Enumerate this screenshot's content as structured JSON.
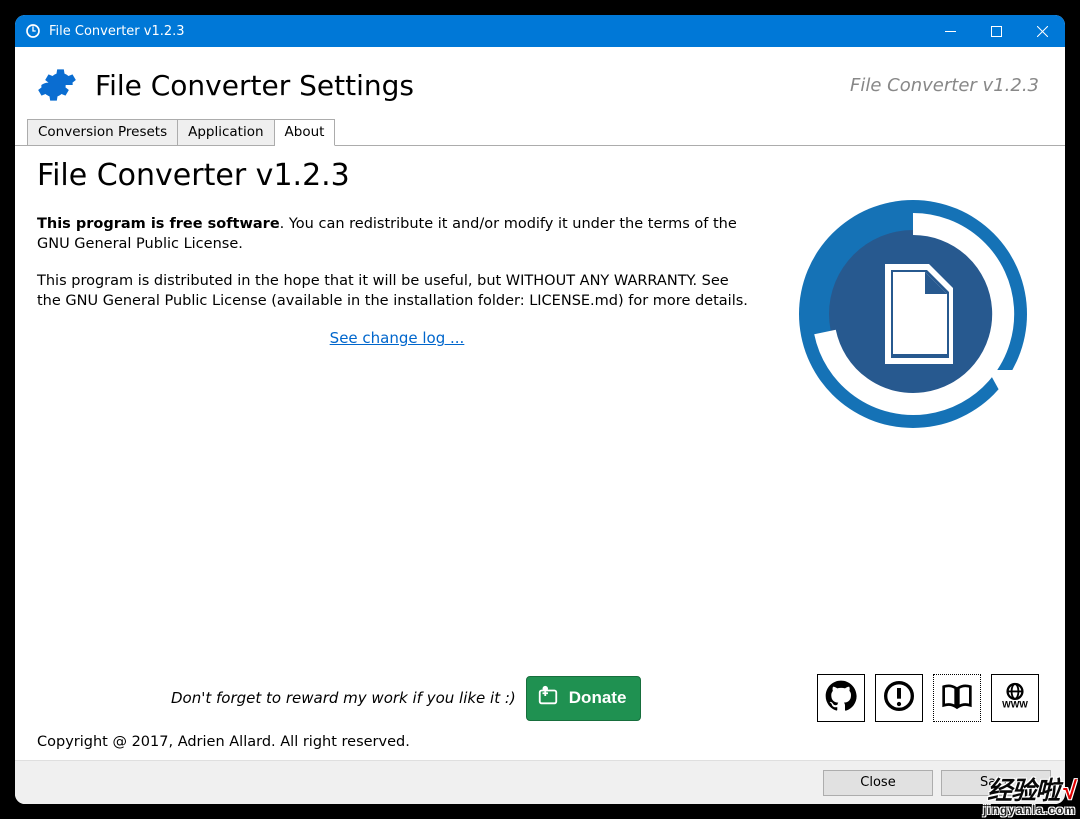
{
  "window": {
    "title": "File Converter v1.2.3"
  },
  "header": {
    "title": "File Converter Settings",
    "version": "File Converter v1.2.3"
  },
  "tabs": [
    {
      "label": "Conversion Presets",
      "active": false
    },
    {
      "label": "Application",
      "active": false
    },
    {
      "label": "About",
      "active": true
    }
  ],
  "about": {
    "app_title": "File Converter v1.2.3",
    "para1_bold": "This program is free software",
    "para1_rest": ". You can redistribute it and/or modify it under the terms of the GNU General Public License.",
    "para2": "This program is distributed in the hope that it will be useful, but WITHOUT ANY WARRANTY. See the GNU General Public License (available in the installation folder: LICENSE.md) for more details.",
    "changelog_link": "See change log ..."
  },
  "donate": {
    "text": "Don't forget to reward my work if you like it :)",
    "button_label": "Donate"
  },
  "link_icons": {
    "github": "github-icon",
    "issues": "alert-circle-icon",
    "docs": "book-open-icon",
    "web": "www-globe-icon"
  },
  "copyright": "Copyright @ 2017, Adrien Allard. All right reserved.",
  "footer": {
    "close_label": "Close",
    "save_label": "Save"
  },
  "watermark": {
    "line1_main": "经验啦",
    "line1_mark": "√",
    "line2": "jingyanla.com"
  },
  "colors": {
    "accent": "#0078d7",
    "gear": "#0a6dd1",
    "logo_ring": "#1572b6",
    "logo_inner": "#27598f",
    "donate_bg": "#1f9151"
  }
}
